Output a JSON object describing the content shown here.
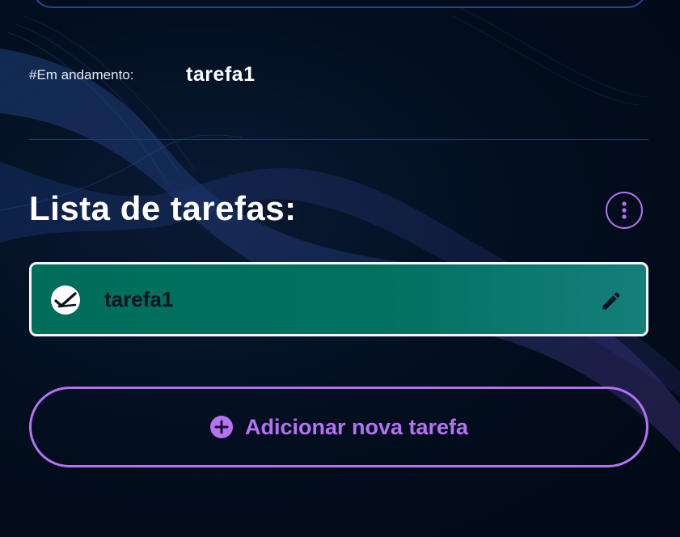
{
  "in_progress": {
    "label": "#Em andamento:",
    "task": "tarefa1"
  },
  "task_list": {
    "title": "Lista de tarefas:",
    "menu_icon": "vertical-dots-icon",
    "items": [
      {
        "name": "tarefa1",
        "completed": true,
        "status_icon": "check-icon",
        "action_icon": "pencil-icon"
      }
    ]
  },
  "add_task": {
    "label": "Adicionar nova tarefa",
    "icon": "plus-circle-icon"
  },
  "colors": {
    "accent": "#b572f2",
    "task_background": "#00705f",
    "background": "#010d1b"
  }
}
